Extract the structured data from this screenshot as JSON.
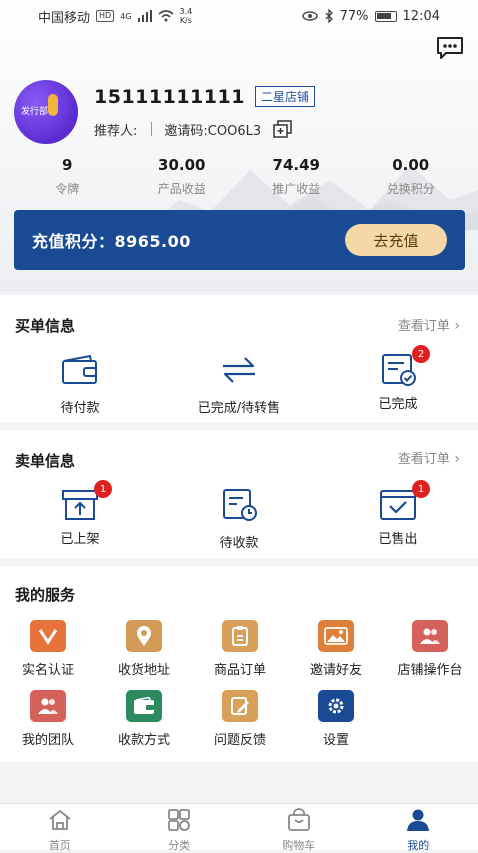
{
  "status_bar": {
    "carrier": "中国移动",
    "hd": "HD",
    "network": "4G",
    "speed_value": "3.4",
    "speed_unit": "K/s",
    "battery": "77%",
    "time": "12:04"
  },
  "profile": {
    "avatar_text": "发行部",
    "phone": "15111111111",
    "level": "二星店铺",
    "referrer_label": "推荐人:",
    "invite_code": "邀请码:COO6L3"
  },
  "stats": [
    {
      "value": "9",
      "label": "令牌"
    },
    {
      "value": "30.00",
      "label": "产品收益"
    },
    {
      "value": "74.49",
      "label": "推广收益"
    },
    {
      "value": "0.00",
      "label": "兑换积分"
    }
  ],
  "recharge": {
    "text": "充值积分：8965.00",
    "button": "去充值"
  },
  "buy_section": {
    "title": "买单信息",
    "view_orders": "查看订单",
    "items": [
      {
        "label": "待付款",
        "badge": ""
      },
      {
        "label": "已完成/待转售",
        "badge": ""
      },
      {
        "label": "已完成",
        "badge": "2"
      }
    ]
  },
  "sell_section": {
    "title": "卖单信息",
    "view_orders": "查看订单",
    "items": [
      {
        "label": "已上架",
        "badge": "1"
      },
      {
        "label": "待收款",
        "badge": ""
      },
      {
        "label": "已售出",
        "badge": "1"
      }
    ]
  },
  "services": {
    "title": "我的服务",
    "items": [
      {
        "label": "实名认证",
        "color": "#e8733a",
        "icon": "verify-icon"
      },
      {
        "label": "收货地址",
        "color": "#d39a55",
        "icon": "location-icon"
      },
      {
        "label": "商品订单",
        "color": "#d9a05a",
        "icon": "clipboard-icon"
      },
      {
        "label": "邀请好友",
        "color": "#e07f3a",
        "icon": "image-icon"
      },
      {
        "label": "店铺操作台",
        "color": "#d6615a",
        "icon": "people-icon"
      },
      {
        "label": "我的团队",
        "color": "#d6615a",
        "icon": "team-icon"
      },
      {
        "label": "收款方式",
        "color": "#2b8a5e",
        "icon": "wallet-icon"
      },
      {
        "label": "问题反馈",
        "color": "#d9a05a",
        "icon": "edit-icon"
      },
      {
        "label": "设置",
        "color": "#1a4a94",
        "icon": "gear-icon"
      }
    ]
  },
  "tabbar": [
    {
      "label": "首页"
    },
    {
      "label": "分类"
    },
    {
      "label": "购物车"
    },
    {
      "label": "我的"
    }
  ]
}
